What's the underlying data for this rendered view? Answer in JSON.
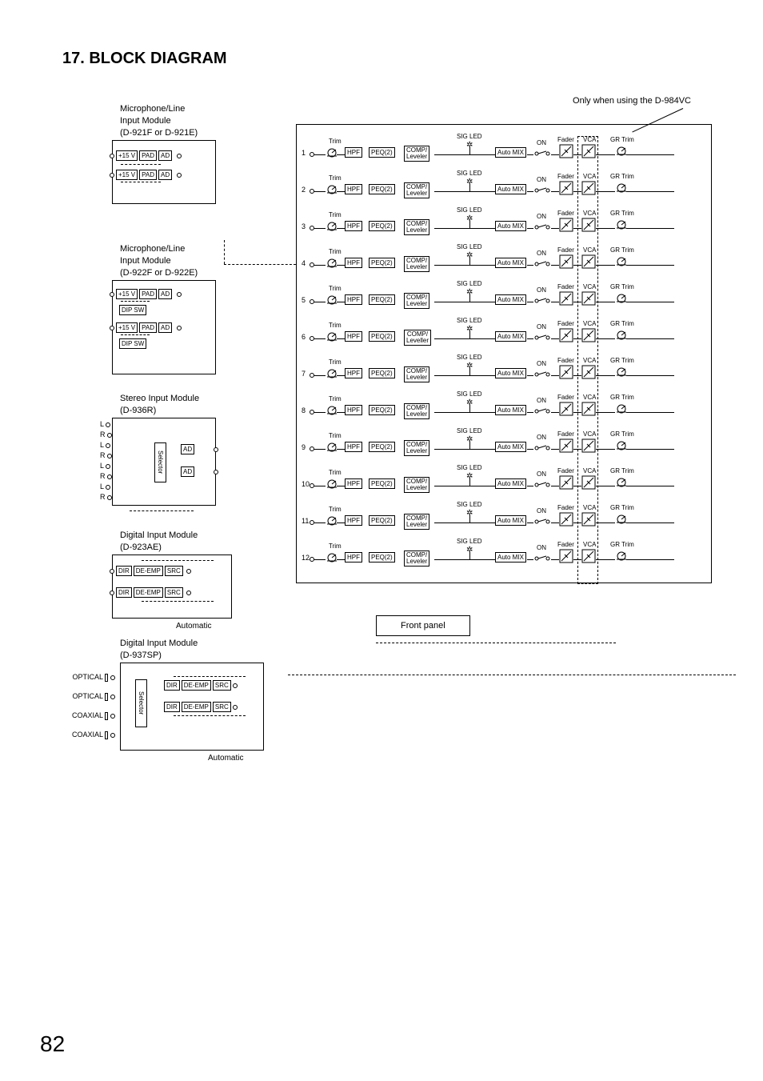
{
  "page_title": "17. BLOCK DIAGRAM",
  "page_number": "82",
  "top_note": "Only when using the D-984VC",
  "left_modules": {
    "mic1": {
      "title1": "Microphone/Line",
      "title2": "Input Module",
      "title3": "(D-921F or D-921E)",
      "b1": "+15 V",
      "b2": "PAD",
      "b3": "AD"
    },
    "mic2": {
      "title1": "Microphone/Line",
      "title2": "Input Module",
      "title3": "(D-922F or D-922E)",
      "b1": "+15 V",
      "b2": "PAD",
      "b3": "AD",
      "dip": "DIP SW"
    },
    "stereo": {
      "title1": "Stereo Input Module",
      "title2": "(D-936R)",
      "sel": "Selector",
      "ad": "AD",
      "L": "L",
      "R": "R"
    },
    "dig1": {
      "title1": "Digital Input Module",
      "title2": "(D-923AE)",
      "dir": "DIR",
      "deemp": "DE-EMP",
      "src": "SRC",
      "auto": "Automatic"
    },
    "dig2": {
      "title1": "Digital Input Module",
      "title2": "(D-937SP)",
      "dir": "DIR",
      "deemp": "DE-EMP",
      "src": "SRC",
      "auto": "Automatic",
      "sel": "Selector",
      "opt": "OPTICAL",
      "coax": "COAXIAL"
    }
  },
  "channel": {
    "trim": "Trim",
    "hpf": "HPF",
    "peq": "PEQ(2)",
    "comp": "COMP/",
    "leveler": "Leveler",
    "leveller": "Leveller",
    "sigled": "SIG LED",
    "automix": "Auto MIX",
    "on": "ON",
    "fader": "Fader",
    "vca": "VCA",
    "grtrim": "GR Trim"
  },
  "front_panel": "Front panel"
}
